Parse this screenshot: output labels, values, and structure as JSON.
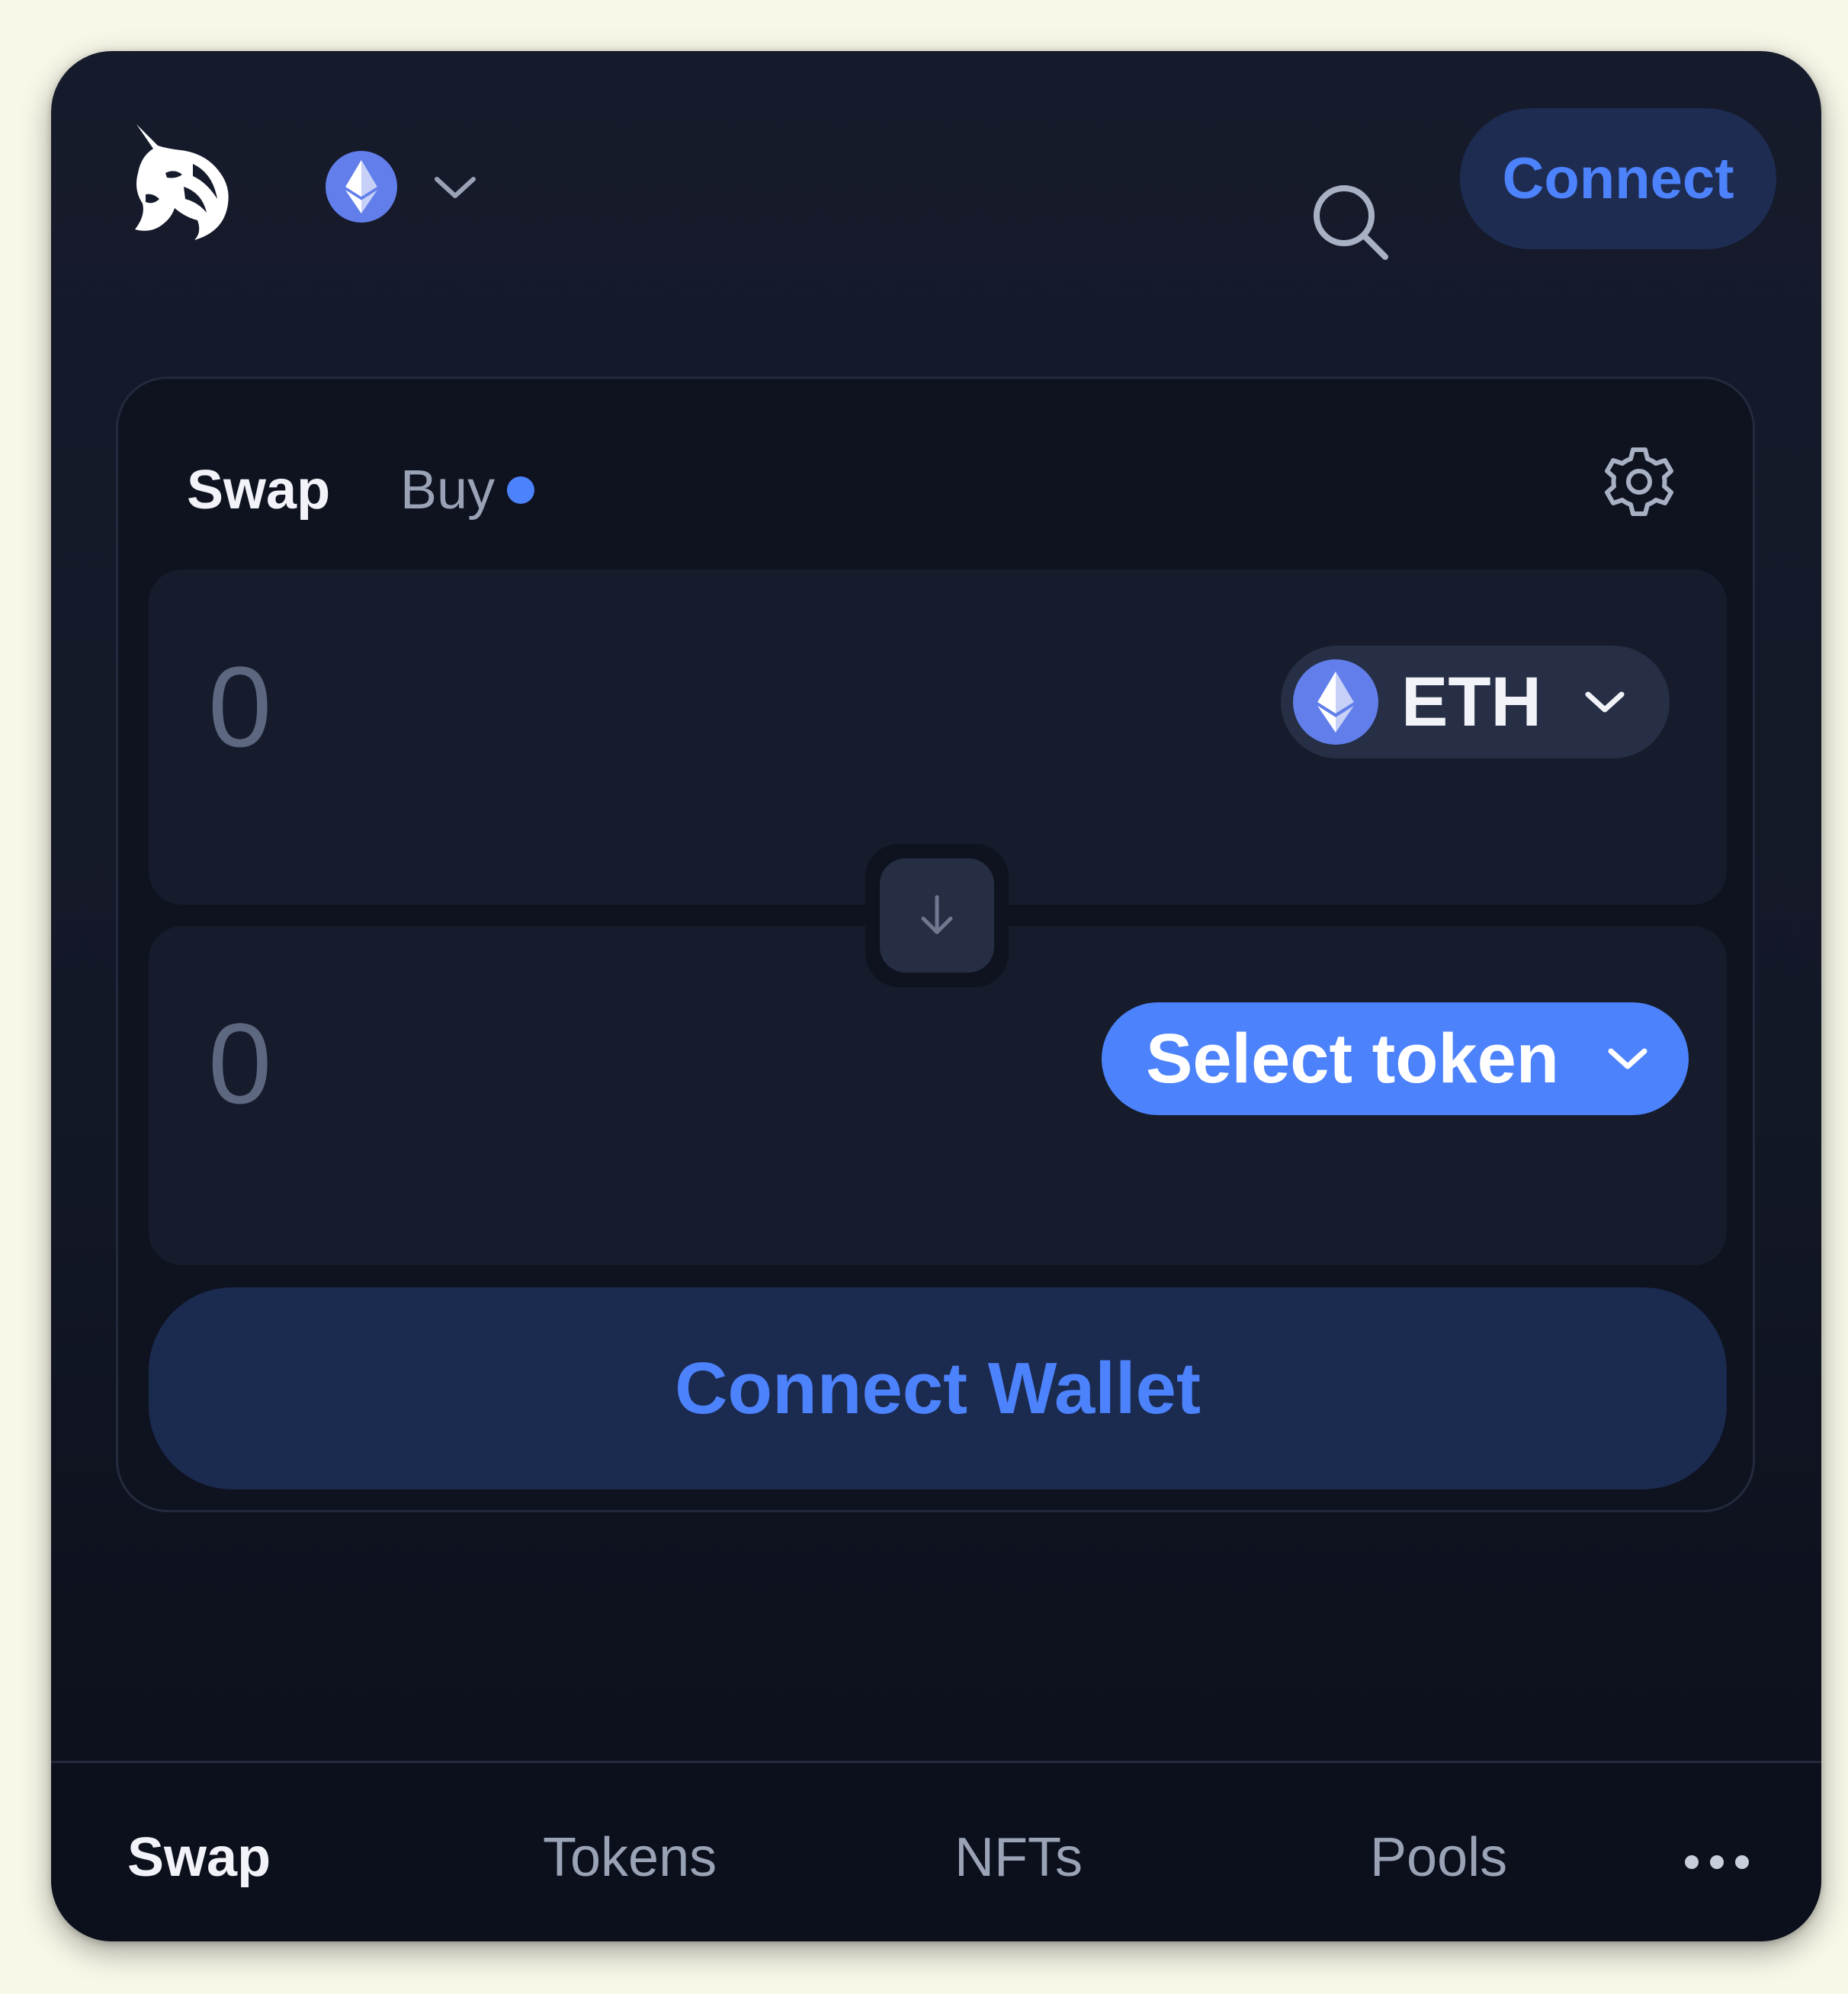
{
  "header": {
    "logo_icon": "uniswap-unicorn-logo",
    "chain_icon": "ethereum-icon",
    "search_icon": "search-icon",
    "connect_label": "Connect"
  },
  "swap_card": {
    "tabs": [
      {
        "label": "Swap",
        "active": true
      },
      {
        "label": "Buy",
        "active": false,
        "indicator": "blue-dot"
      }
    ],
    "settings_icon": "gear-icon",
    "sell": {
      "amount": "0",
      "token_symbol": "ETH",
      "token_icon": "ethereum-icon"
    },
    "buy": {
      "amount": "0",
      "select_label": "Select token"
    },
    "switch_icon": "arrow-down-icon",
    "connect_wallet_label": "Connect Wallet"
  },
  "bottom_nav": {
    "items": [
      {
        "label": "Swap",
        "active": true
      },
      {
        "label": "Tokens",
        "active": false
      },
      {
        "label": "NFTs",
        "active": false
      },
      {
        "label": "Pools",
        "active": false
      }
    ],
    "more_icon": "more-dots-icon"
  },
  "colors": {
    "page_background": "#f8f8e9",
    "app_background": "#131827",
    "accent": "#4c82fb",
    "accent_soft": "#1e2c52",
    "eth_purple": "#627eea"
  }
}
